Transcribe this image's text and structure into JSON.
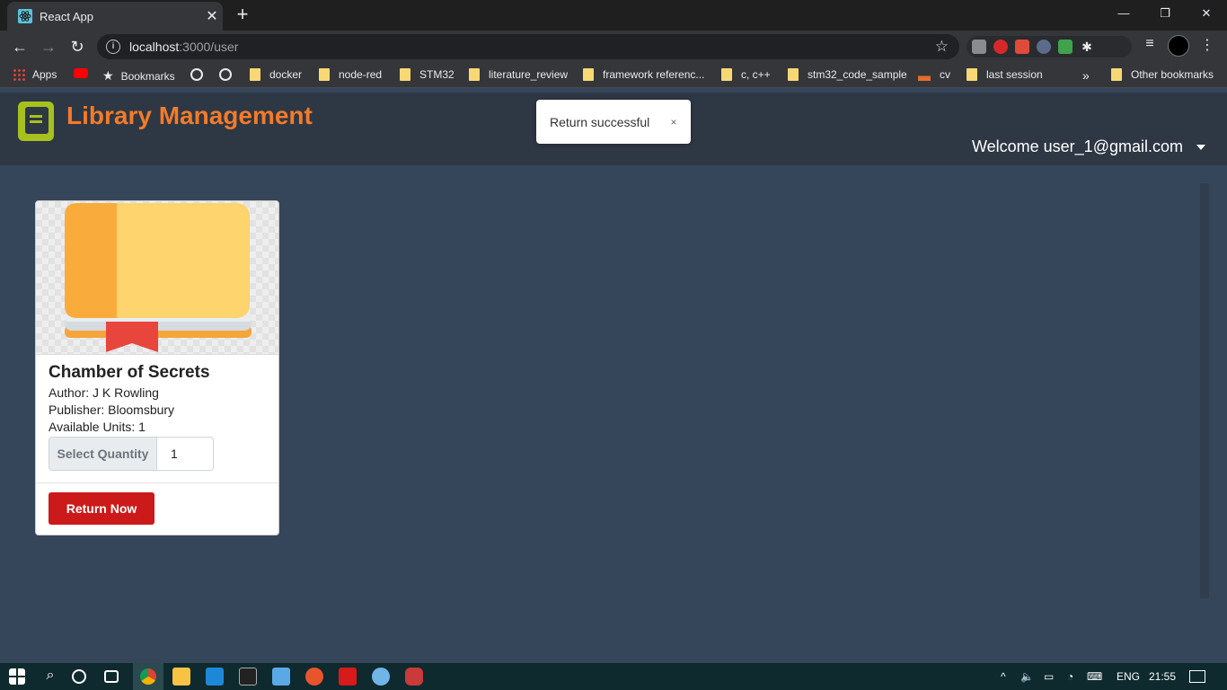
{
  "browser": {
    "tab_title": "React App",
    "url_host": "localhost",
    "url_path": ":3000/user",
    "bookmarks": [
      "Apps",
      "Bookmarks",
      "docker",
      "node-red",
      "STM32",
      "literature_review",
      "framework referenc...",
      "c, c++",
      "stm32_code_sample",
      "cv",
      "last session",
      "Other bookmarks"
    ],
    "overflow_label": "»"
  },
  "app": {
    "title": "Library Management",
    "welcome": "Welcome user_1@gmail.com"
  },
  "toast": {
    "message": "Return successful",
    "close": "×"
  },
  "book": {
    "title": "Chamber of Secrets",
    "author": "Author: J K Rowling",
    "publisher": "Publisher: Bloomsbury",
    "available": "Available Units: 1",
    "quantity_label": "Select Quantity",
    "quantity_value": "1",
    "return_button": "Return Now"
  },
  "taskbar": {
    "language": "ENG",
    "time": "21:55"
  }
}
